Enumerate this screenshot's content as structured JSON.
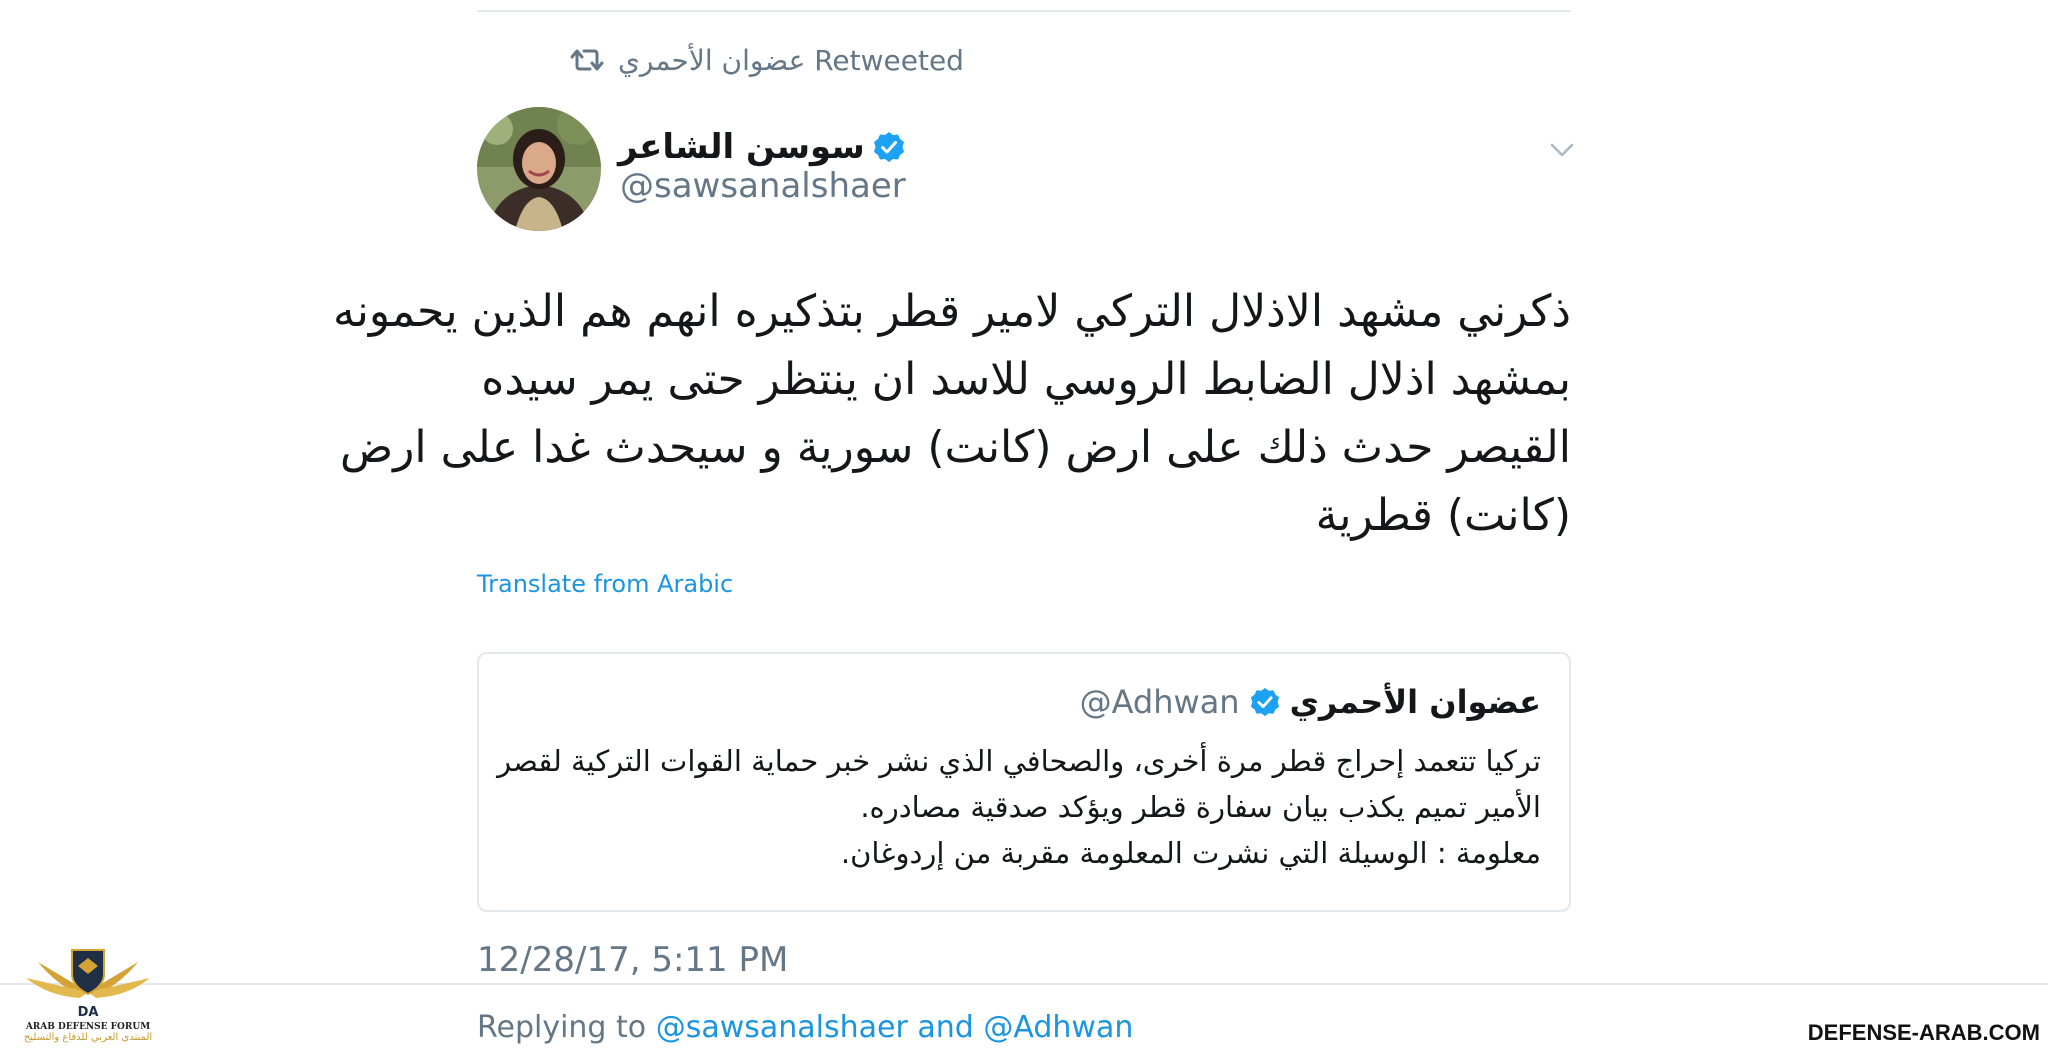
{
  "retweet": {
    "icon": "retweet-icon",
    "label": "عضوان الأحمري Retweeted"
  },
  "author": {
    "name": "سوسن الشاعر",
    "handle": "@sawsanalshaer",
    "verified": true
  },
  "tweet": {
    "lines": [
      "ذكرني مشهد الاذلال التركي لامير قطر بتذكيره انهم هم الذين يحمونه",
      "بمشهد اذلال الضابط الروسي للاسد ان ينتظر حتى يمر سيده",
      "القيصر حدث ذلك على ارض (كانت) سورية و سيحدث غدا على ارض",
      "(كانت) قطرية"
    ],
    "translate_label": "Translate from Arabic",
    "timestamp": "12/28/17, 5:11 PM"
  },
  "quote": {
    "name": "عضوان الأحمري",
    "handle": "@Adhwan",
    "verified": true,
    "lines": [
      "تركيا تتعمد إحراج قطر مرة أخرى، والصحافي الذي نشر خبر حماية القوات التركية لقصر",
      "الأمير تميم يكذب بيان سفارة قطر ويؤكد صدقية مصادره.",
      "معلومة : الوسيلة التي نشرت المعلومة مقربة من إردوغان."
    ]
  },
  "replying": {
    "prefix": "Replying to",
    "mention_1": "@sawsanalshaer",
    "conjunction": "and",
    "mention_2": "@Adhwan"
  },
  "watermark": {
    "logo_text_en": "ARAB DEFENSE FORUM",
    "logo_text_ar": "المنتدى العربي للدفاع والتسليح",
    "logo_monogram": "DA",
    "site": "DEFENSE-ARAB.COM"
  },
  "colors": {
    "link": "#1b95e0",
    "secondary_text": "#657786",
    "divider": "#e1e8ed",
    "verified": "#1da1f2"
  }
}
